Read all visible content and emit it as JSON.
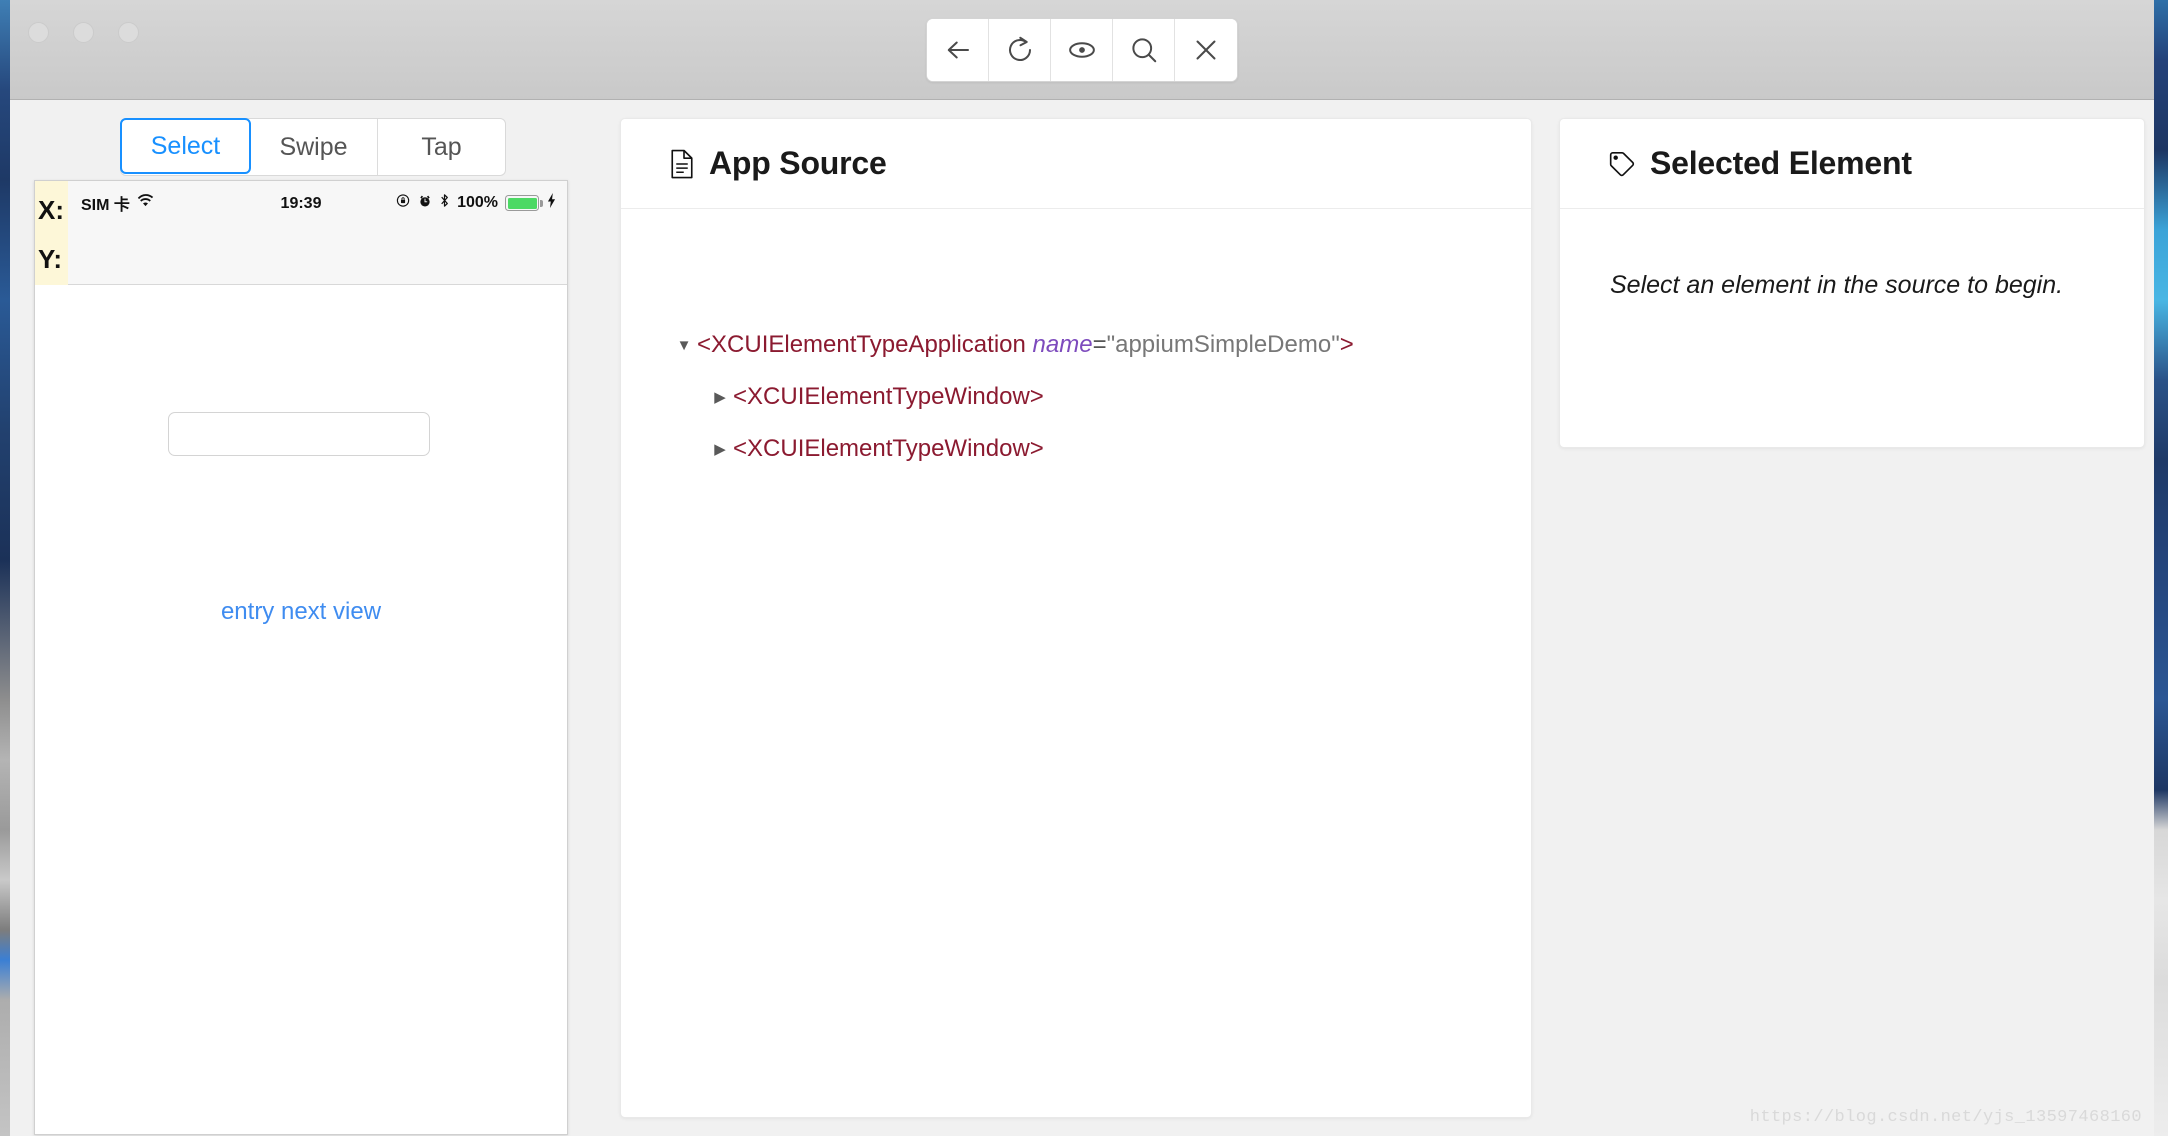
{
  "window": {
    "traffic_lights": [
      "close",
      "minimize",
      "maximize"
    ]
  },
  "toolbar": {
    "buttons": [
      {
        "name": "back",
        "icon": "arrow-left-icon"
      },
      {
        "name": "refresh",
        "icon": "refresh-icon"
      },
      {
        "name": "inspect",
        "icon": "eye-icon"
      },
      {
        "name": "search",
        "icon": "search-icon"
      },
      {
        "name": "close",
        "icon": "close-icon"
      }
    ]
  },
  "device_column": {
    "tabs": [
      {
        "label": "Select",
        "active": true
      },
      {
        "label": "Swipe",
        "active": false
      },
      {
        "label": "Tap",
        "active": false
      }
    ],
    "coordinates": {
      "x_label": "X:",
      "y_label": "Y:",
      "x_value": "",
      "y_value": ""
    },
    "status_bar": {
      "carrier": "SIM 卡",
      "wifi_icon": "wifi-icon",
      "time": "19:39",
      "rotation_lock_icon": "rotation-lock-icon",
      "alarm_icon": "alarm-clock-icon",
      "bluetooth_icon": "bluetooth-icon",
      "battery_percent": "100%",
      "battery_color": "#4cd964",
      "charging_icon": "lightning-bolt-icon"
    },
    "screen": {
      "textfield_value": "",
      "textfield_placeholder": "",
      "link_label": "entry next view",
      "link_color": "#3f8cf0"
    }
  },
  "app_source": {
    "title": "App Source",
    "icon": "document-icon",
    "tree": [
      {
        "depth": 0,
        "expanded": true,
        "caret": "▼",
        "open_bracket": "<",
        "tag": "XCUIElementTypeApplication",
        "attr_name": "name",
        "attr_eq": "=",
        "attr_value": "\"appiumSimpleDemo\"",
        "close_bracket": ">"
      },
      {
        "depth": 1,
        "expanded": false,
        "caret": "▶",
        "open_bracket": "<",
        "tag": "XCUIElementTypeWindow",
        "attr_name": "",
        "attr_eq": "",
        "attr_value": "",
        "close_bracket": ">"
      },
      {
        "depth": 1,
        "expanded": false,
        "caret": "▶",
        "open_bracket": "<",
        "tag": "XCUIElementTypeWindow",
        "attr_name": "",
        "attr_eq": "",
        "attr_value": "",
        "close_bracket": ">"
      }
    ]
  },
  "selected_element": {
    "title": "Selected Element",
    "icon": "tag-icon",
    "placeholder": "Select an element in the source to begin."
  },
  "watermark": "https://blog.csdn.net/yjs_13597468160",
  "colors": {
    "accent_blue": "#1890ff",
    "tag_red": "#8b1a30",
    "attr_purple": "#7d4bbd",
    "coord_bg": "#fdf7d8"
  }
}
